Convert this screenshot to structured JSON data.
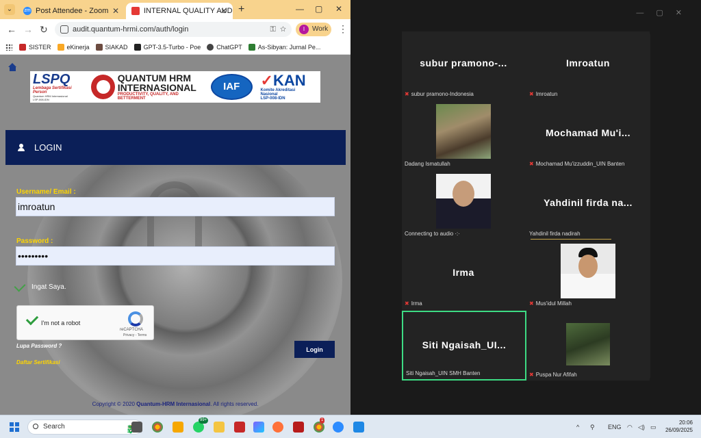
{
  "browser": {
    "tabs": [
      {
        "title": "Post Attendee - Zoom"
      },
      {
        "title": "INTERNAL QUALITY AUDITOR",
        "active": true
      }
    ],
    "url": "audit.quantum-hrmi.com/auth/login",
    "profile": {
      "initial": "I",
      "label": "Work"
    },
    "bookmarks": [
      "SISTER",
      "eKinerja",
      "SIAKAD",
      "GPT-3.5-Turbo - Poe",
      "ChatGPT",
      "As-Sibyan: Jurnal Pe..."
    ]
  },
  "page": {
    "logos": {
      "lsp": {
        "name": "LSPQ",
        "line1": "Lembaga Sertifikasi Person",
        "line2": "Quantum HRM Internasional",
        "line3": "LSP-008-IDN"
      },
      "quantum": {
        "line1": "QUANTUM HRM",
        "line2": "INTERNASIONAL",
        "tagline": "PRODUCTIVITY, QUALITY, AND BETTERMENT"
      },
      "iaf": "IAF",
      "kan": {
        "name_a": "✓",
        "name_b": "KAN",
        "line1": "Komite Akreditasi Nasional",
        "line2": "LSP-008-IDN"
      }
    },
    "login_header": "LOGIN",
    "username_label": "Username/ Email :",
    "username_value": "imroatun",
    "password_label": "Password :",
    "password_value": "•••••••••",
    "remember_label": "Ingat Saya.",
    "recaptcha": {
      "text": "I'm not a robot",
      "brand": "reCAPTCHA",
      "links": "Privacy - Terms"
    },
    "forgot_link": "Lupa Password ?",
    "cert_link": "Daftar Sertifikasi",
    "login_button": "Login",
    "copyright_pre": "Copyright © 2020 ",
    "copyright_brand": "Quantum-HRM Internasional",
    "copyright_post": ". All rights reserved."
  },
  "zoom": {
    "tiles": [
      {
        "big": "subur  pramono-...",
        "name": "subur pramono-Indonesia",
        "muted": true
      },
      {
        "big": "Imroatun",
        "name": "Imroatun",
        "muted": true
      },
      {
        "big": "",
        "name": "Dadang Ismatullah",
        "muted": false,
        "video": true
      },
      {
        "big": "Mochamad  Mu'i...",
        "name": "Mochamad Mu'izzuddin_UIN Banten",
        "muted": true
      },
      {
        "big": "",
        "name": "Connecting to audio ·:·",
        "muted": false,
        "video": true
      },
      {
        "big": "Yahdinil  firda  na...",
        "name": "Yahdinil firda nadirah",
        "muted": false
      },
      {
        "big": "Irma",
        "name": "Irma",
        "muted": true
      },
      {
        "big": "",
        "name": "Mus'idul Millah",
        "muted": true,
        "video": true
      },
      {
        "big": "Siti  Ngaisah_UI...",
        "name": "Siti Ngaisah_UIN SMH Banten",
        "muted": false,
        "active": true
      },
      {
        "big": "",
        "name": "Puspa Nur Afifah",
        "muted": true,
        "video": true
      }
    ]
  },
  "taskbar": {
    "search_label": "Search",
    "whatsapp_badge": "99+",
    "chrome_badge": "1",
    "language": "ENG",
    "time": "20:06",
    "date": "26/09/2025"
  }
}
